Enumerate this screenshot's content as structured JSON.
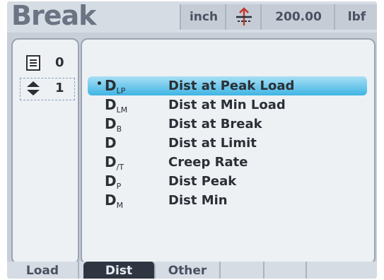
{
  "header": {
    "title": "Break",
    "unit": "inch",
    "value": "200.00",
    "force_unit": "lbf",
    "icon": "position-arrow-icon"
  },
  "left_panel": {
    "rows": [
      {
        "icon": "document-list-icon",
        "value": "0"
      },
      {
        "icon": "up-down-icon",
        "value": "1"
      }
    ]
  },
  "list": {
    "items": [
      {
        "marker": "•",
        "symbol": "D",
        "subscript": "LP",
        "label": "Dist at Peak Load",
        "selected": true
      },
      {
        "marker": "",
        "symbol": "D",
        "subscript": "LM",
        "label": "Dist at Min Load",
        "selected": false
      },
      {
        "marker": "",
        "symbol": "D",
        "subscript": "B",
        "label": "Dist at Break",
        "selected": false
      },
      {
        "marker": "",
        "symbol": "D",
        "subscript": "",
        "label": "Dist at Limit",
        "selected": false
      },
      {
        "marker": "",
        "symbol": "D",
        "subscript": "/T",
        "label": "Creep Rate",
        "selected": false
      },
      {
        "marker": "",
        "symbol": "D",
        "subscript": "P",
        "label": "Dist Peak",
        "selected": false
      },
      {
        "marker": "",
        "symbol": "D",
        "subscript": "M",
        "label": "Dist Min",
        "selected": false
      }
    ]
  },
  "tabs": [
    {
      "label": "Load",
      "active": false
    },
    {
      "label": "Dist",
      "active": true
    },
    {
      "label": "Other",
      "active": false
    },
    {
      "label": "",
      "active": false
    },
    {
      "label": "",
      "active": false
    },
    {
      "label": "",
      "active": false
    }
  ],
  "colors": {
    "selection": "#3fb5e3",
    "active_tab": "#2f3642",
    "background": "#c8cfd8"
  }
}
